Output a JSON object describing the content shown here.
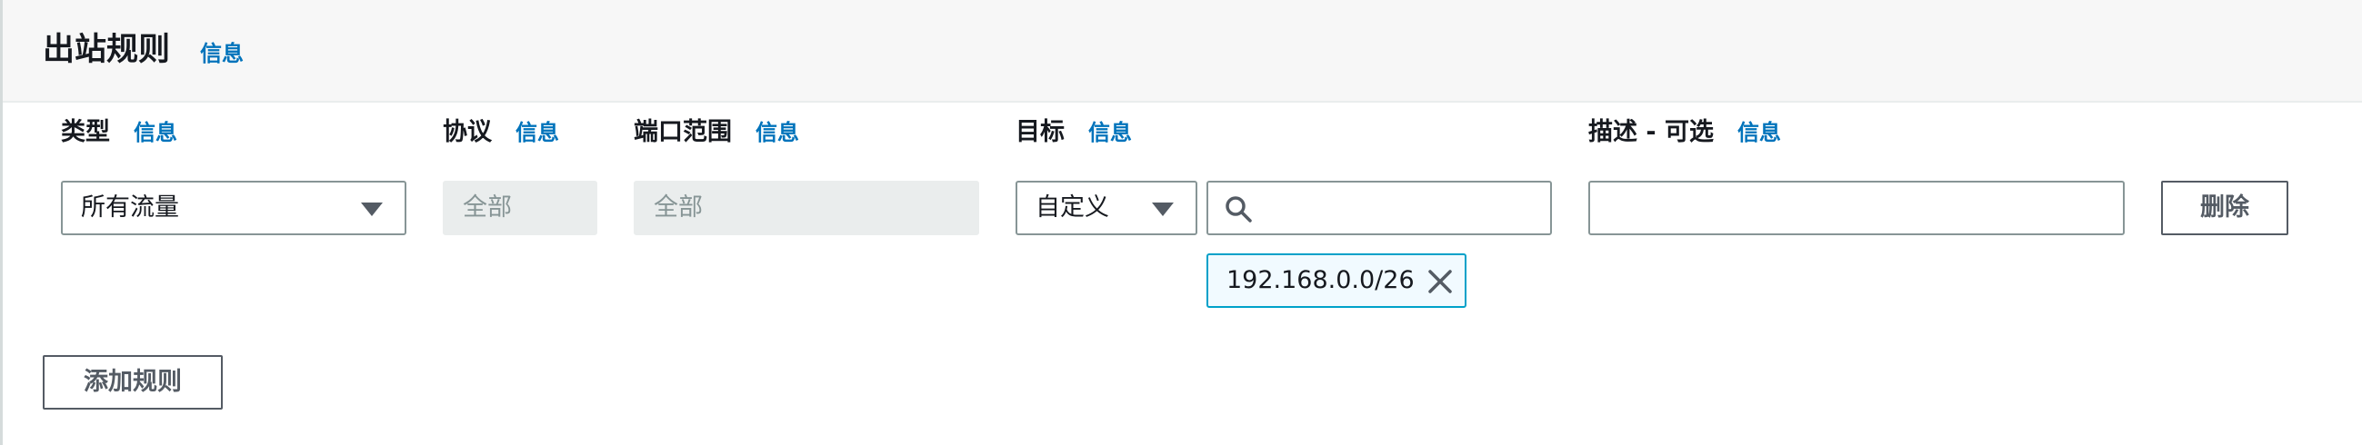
{
  "section": {
    "title": "出站规则",
    "info_link": "信息"
  },
  "columns": {
    "type": {
      "label": "类型",
      "info": "信息"
    },
    "protocol": {
      "label": "协议",
      "info": "信息"
    },
    "port_range": {
      "label": "端口范围",
      "info": "信息"
    },
    "destination": {
      "label": "目标",
      "info": "信息"
    },
    "description": {
      "label": "描述 - 可选",
      "info": "信息"
    }
  },
  "rule": {
    "type_value": "所有流量",
    "protocol_value": "全部",
    "port_range_value": "全部",
    "destination_mode": "自定义",
    "destination_search": "",
    "destination_tokens": [
      "192.168.0.0/26"
    ],
    "description_value": "",
    "delete_label": "删除"
  },
  "actions": {
    "add_rule_label": "添加规则"
  },
  "icons": {
    "dropdown": "caret-down-icon",
    "search": "search-icon",
    "remove_token": "close-icon"
  },
  "colors": {
    "link": "#0073bb",
    "token_border": "#00a1c9",
    "token_bg": "#f1faff",
    "disabled_bg": "#eaeded",
    "header_bg": "#f7f7f7"
  }
}
